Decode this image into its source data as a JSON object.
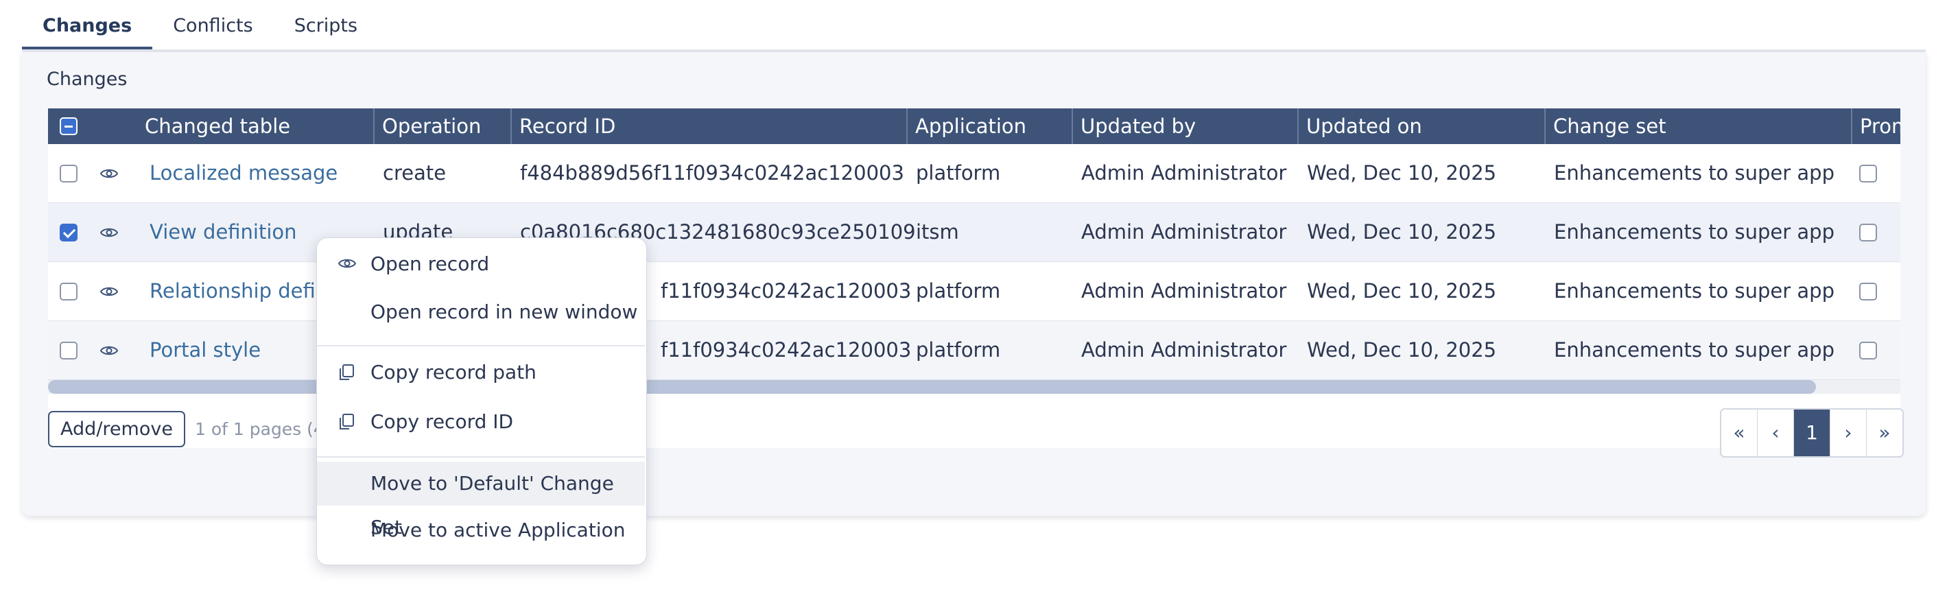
{
  "tabs": [
    "Changes",
    "Conflicts",
    "Scripts"
  ],
  "card_title": "Changes",
  "columns": [
    "Changed table",
    "Operation",
    "Record ID",
    "Application",
    "Updated by",
    "Updated on",
    "Change set",
    "Prom"
  ],
  "rows": [
    {
      "table": "Localized message",
      "operation": "create",
      "record_id": "f484b889d56f11f0934c0242ac120003",
      "application": "platform",
      "updated_by": "Admin Administrator",
      "updated_on": "Wed, Dec 10, 2025",
      "change_set": "Enhancements to super app",
      "checked": false
    },
    {
      "table": "View definition",
      "operation": "update",
      "record_id": "c0a8016c680c132481680c93ce250109",
      "application": "itsm",
      "updated_by": "Admin Administrator",
      "updated_on": "Wed, Dec 10, 2025",
      "change_set": "Enhancements to super app",
      "checked": true
    },
    {
      "table": "Relationship defini",
      "operation": "",
      "record_id": "f11f0934c0242ac120003",
      "application": "platform",
      "updated_by": "Admin Administrator",
      "updated_on": "Wed, Dec 10, 2025",
      "change_set": "Enhancements to super app",
      "checked": false
    },
    {
      "table": "Portal style",
      "operation": "",
      "record_id": "f11f0934c0242ac120003",
      "application": "platform",
      "updated_by": "Admin Administrator",
      "updated_on": "Wed, Dec 10, 2025",
      "change_set": "Enhancements to super app",
      "checked": false
    }
  ],
  "footer": {
    "add_remove": "Add/remove",
    "pages_info": "1 of 1 pages (4 i",
    "pager": [
      "«",
      "‹",
      "1",
      "›",
      "»"
    ]
  },
  "context_menu": {
    "open_record": "Open record",
    "open_new_window": "Open record in new window",
    "copy_path": "Copy record path",
    "copy_id": "Copy record ID",
    "move_default": "Move to 'Default' Change Set",
    "move_active": "Move to active Application"
  },
  "colors": {
    "header": "#3e5378",
    "link": "#3a6d9e",
    "checkbox": "#3a6fcf"
  }
}
